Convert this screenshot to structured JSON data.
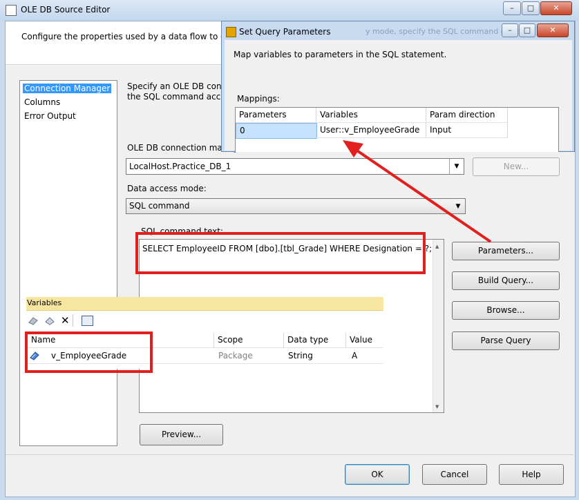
{
  "main_window": {
    "title": "OLE DB Source Editor",
    "description": "Configure the properties used by a data flow to obtain",
    "description_tail": "y mode, specify the SQL command either by",
    "nav_items": [
      "Connection Manager",
      "Columns",
      "Error Output"
    ],
    "specify_line1": "Specify an OLE DB connec",
    "specify_line2": "the SQL command access",
    "connection_label": "OLE DB connection manag",
    "connection_value": "LocalHost.Practice_DB_1",
    "new_button": "New...",
    "access_mode_label": "Data access mode:",
    "access_mode_value": "SQL command",
    "sql_label": "SQL command text:",
    "sql_text": "SELECT EmployeeID FROM [dbo].[tbl_Grade] WHERE Designation = ?;",
    "parameters_button": "Parameters...",
    "build_query_button": "Build Query...",
    "browse_button": "Browse...",
    "parse_query_button": "Parse Query",
    "preview_button": "Preview...",
    "ok_button": "OK",
    "cancel_button": "Cancel",
    "help_button": "Help"
  },
  "query_dialog": {
    "title": "Set Query Parameters",
    "instruction": "Map variables to parameters in the SQL statement.",
    "mappings_label": "Mappings:",
    "columns": [
      "Parameters",
      "Variables",
      "Param direction"
    ],
    "rows": [
      {
        "parameter": "0",
        "variable": "User::v_EmployeeGrade",
        "direction": "Input"
      }
    ]
  },
  "variables_panel": {
    "title": "Variables",
    "columns": [
      "Name",
      "Scope",
      "Data type",
      "Value"
    ],
    "rows": [
      {
        "name": "v_EmployeeGrade",
        "scope": "Package",
        "data_type": "String",
        "value": "A"
      }
    ]
  },
  "window_controls": {
    "minimize": "–",
    "maximize": "□",
    "close": "✕"
  },
  "colors": {
    "annotation_red": "#e21f1f",
    "selection_blue": "#3399ff",
    "variables_header": "#f6e6a0"
  }
}
